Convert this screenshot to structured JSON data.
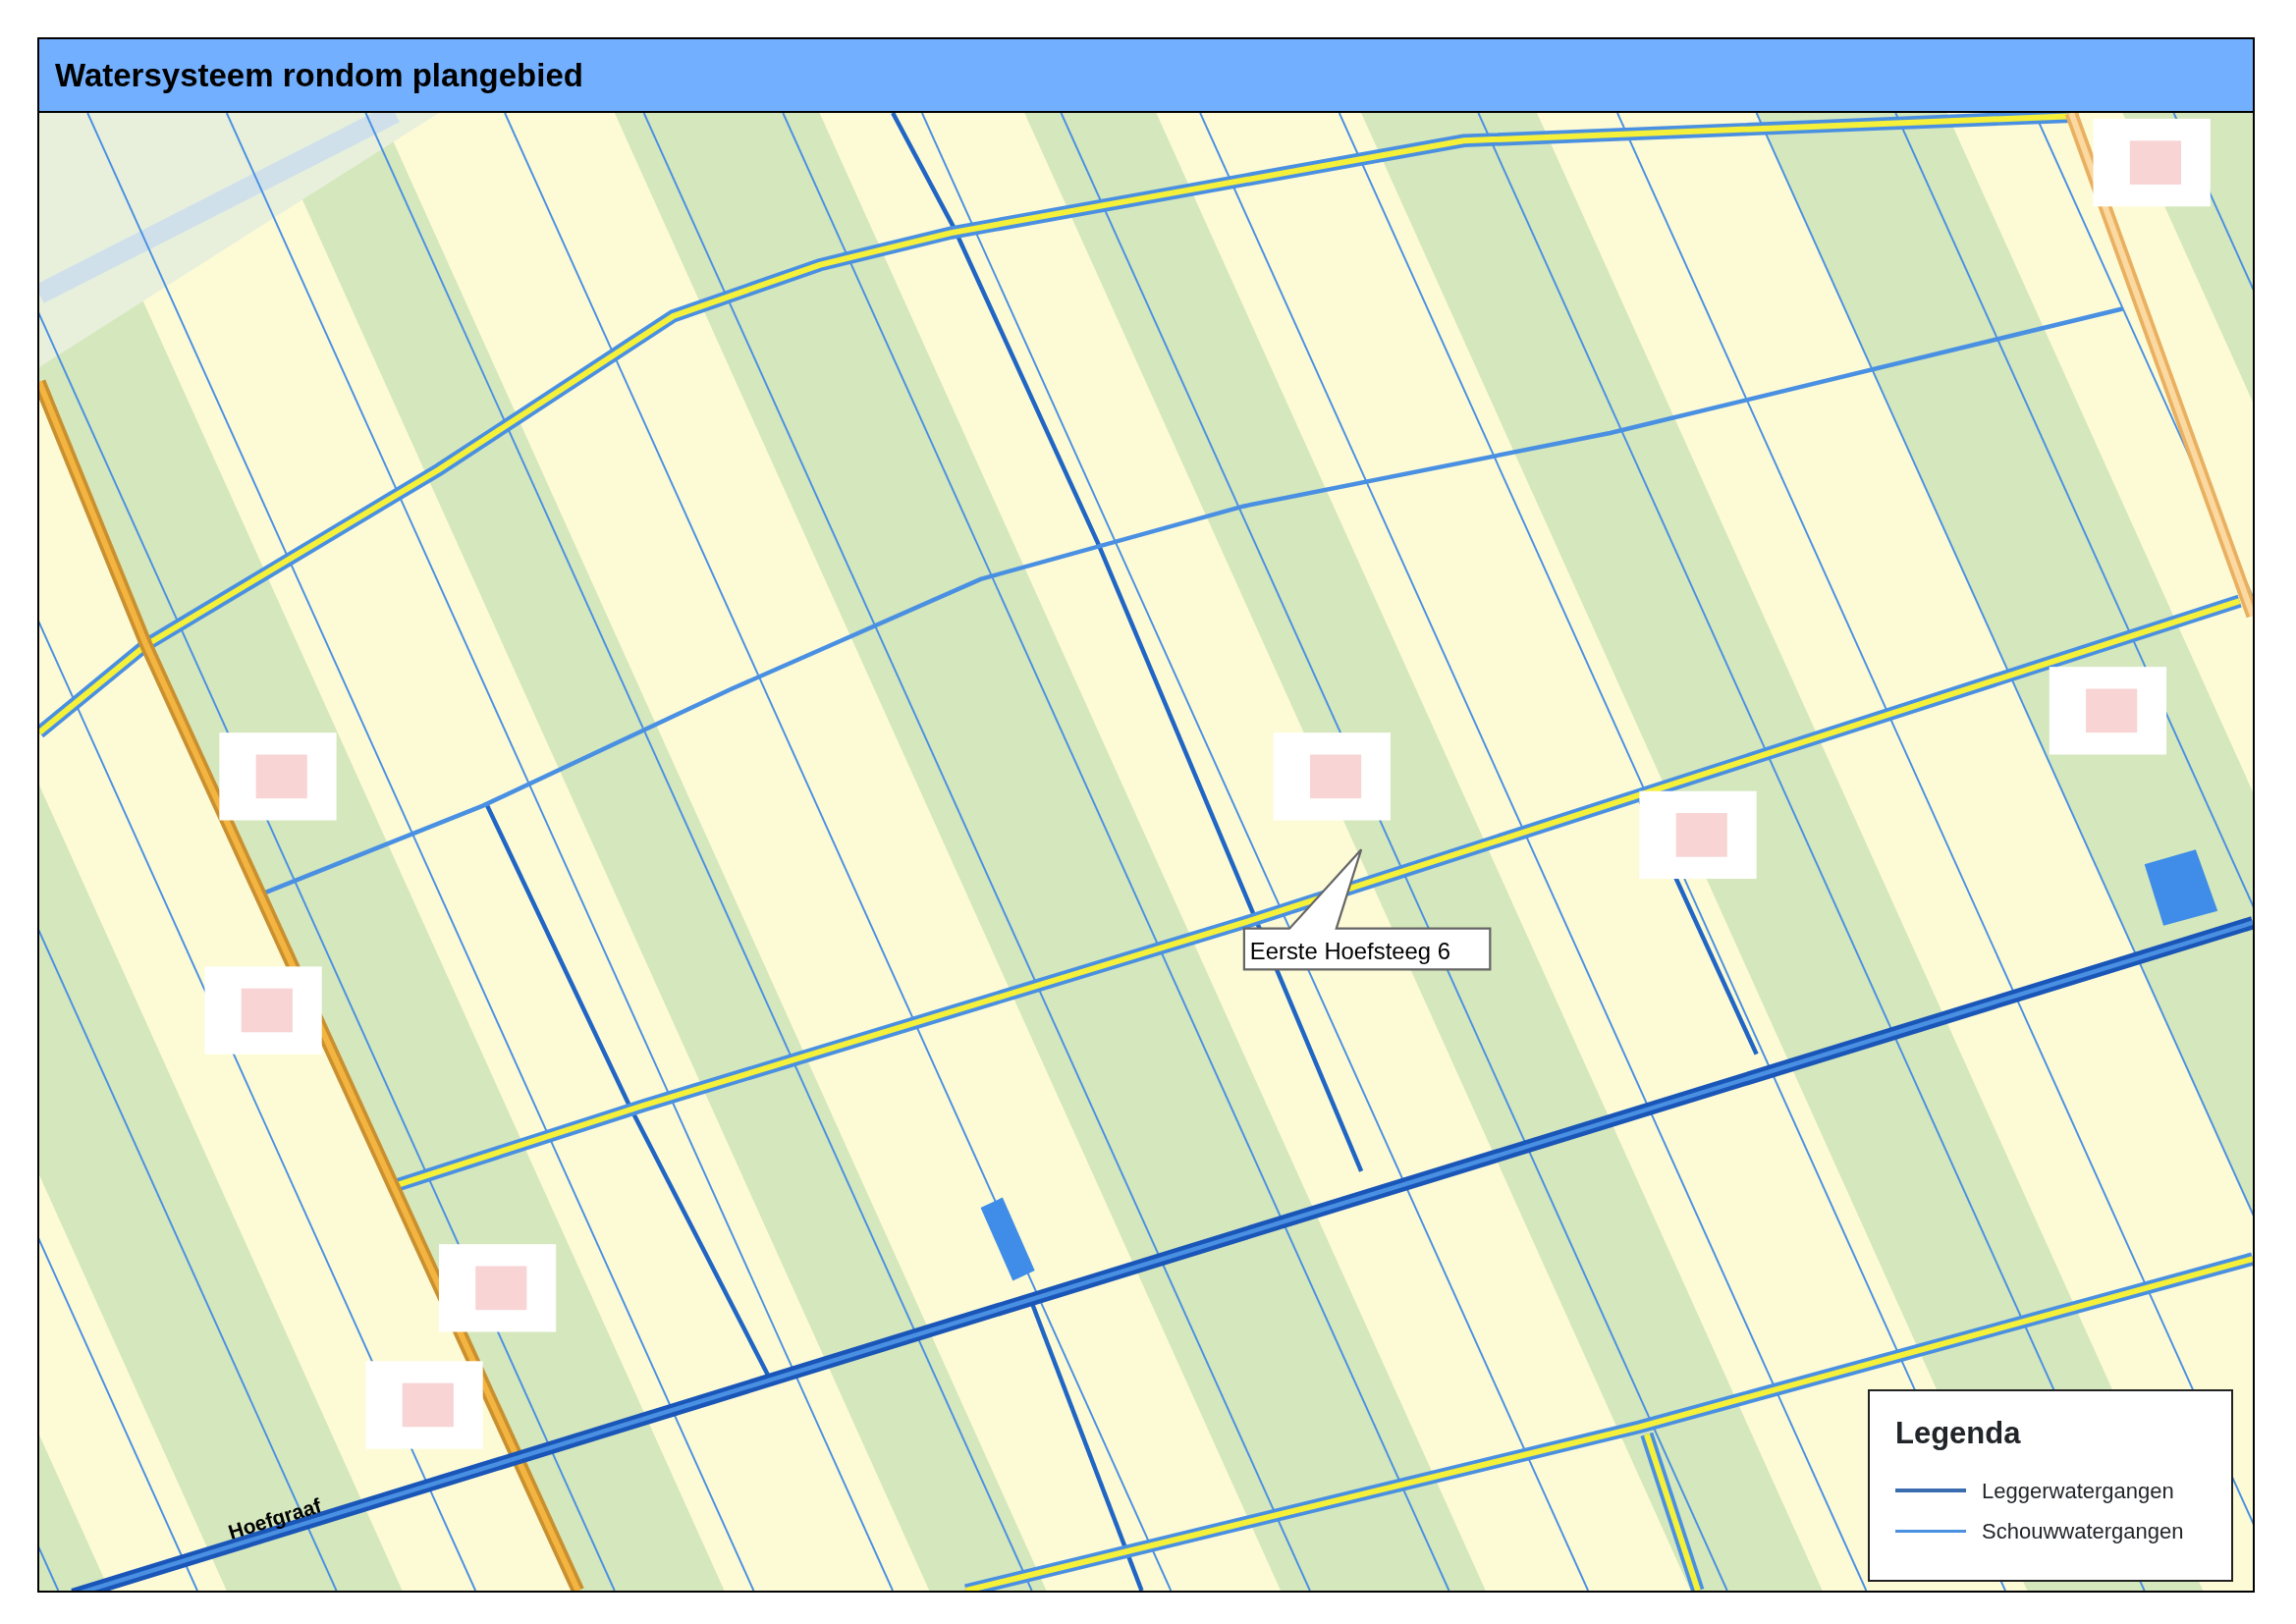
{
  "title": "Watersysteem rondom plangebied",
  "map": {
    "labels": [
      {
        "kind": "callout",
        "text": "Eerste Hoefsteeg 6"
      },
      {
        "kind": "street",
        "text": "Hoefgraaf"
      }
    ]
  },
  "legend": {
    "title": "Legenda",
    "items": [
      {
        "label": "Leggerwatergangen",
        "color": "#3a6db0"
      },
      {
        "label": "Schouwwatergangen",
        "color": "#4a90e2"
      }
    ]
  }
}
